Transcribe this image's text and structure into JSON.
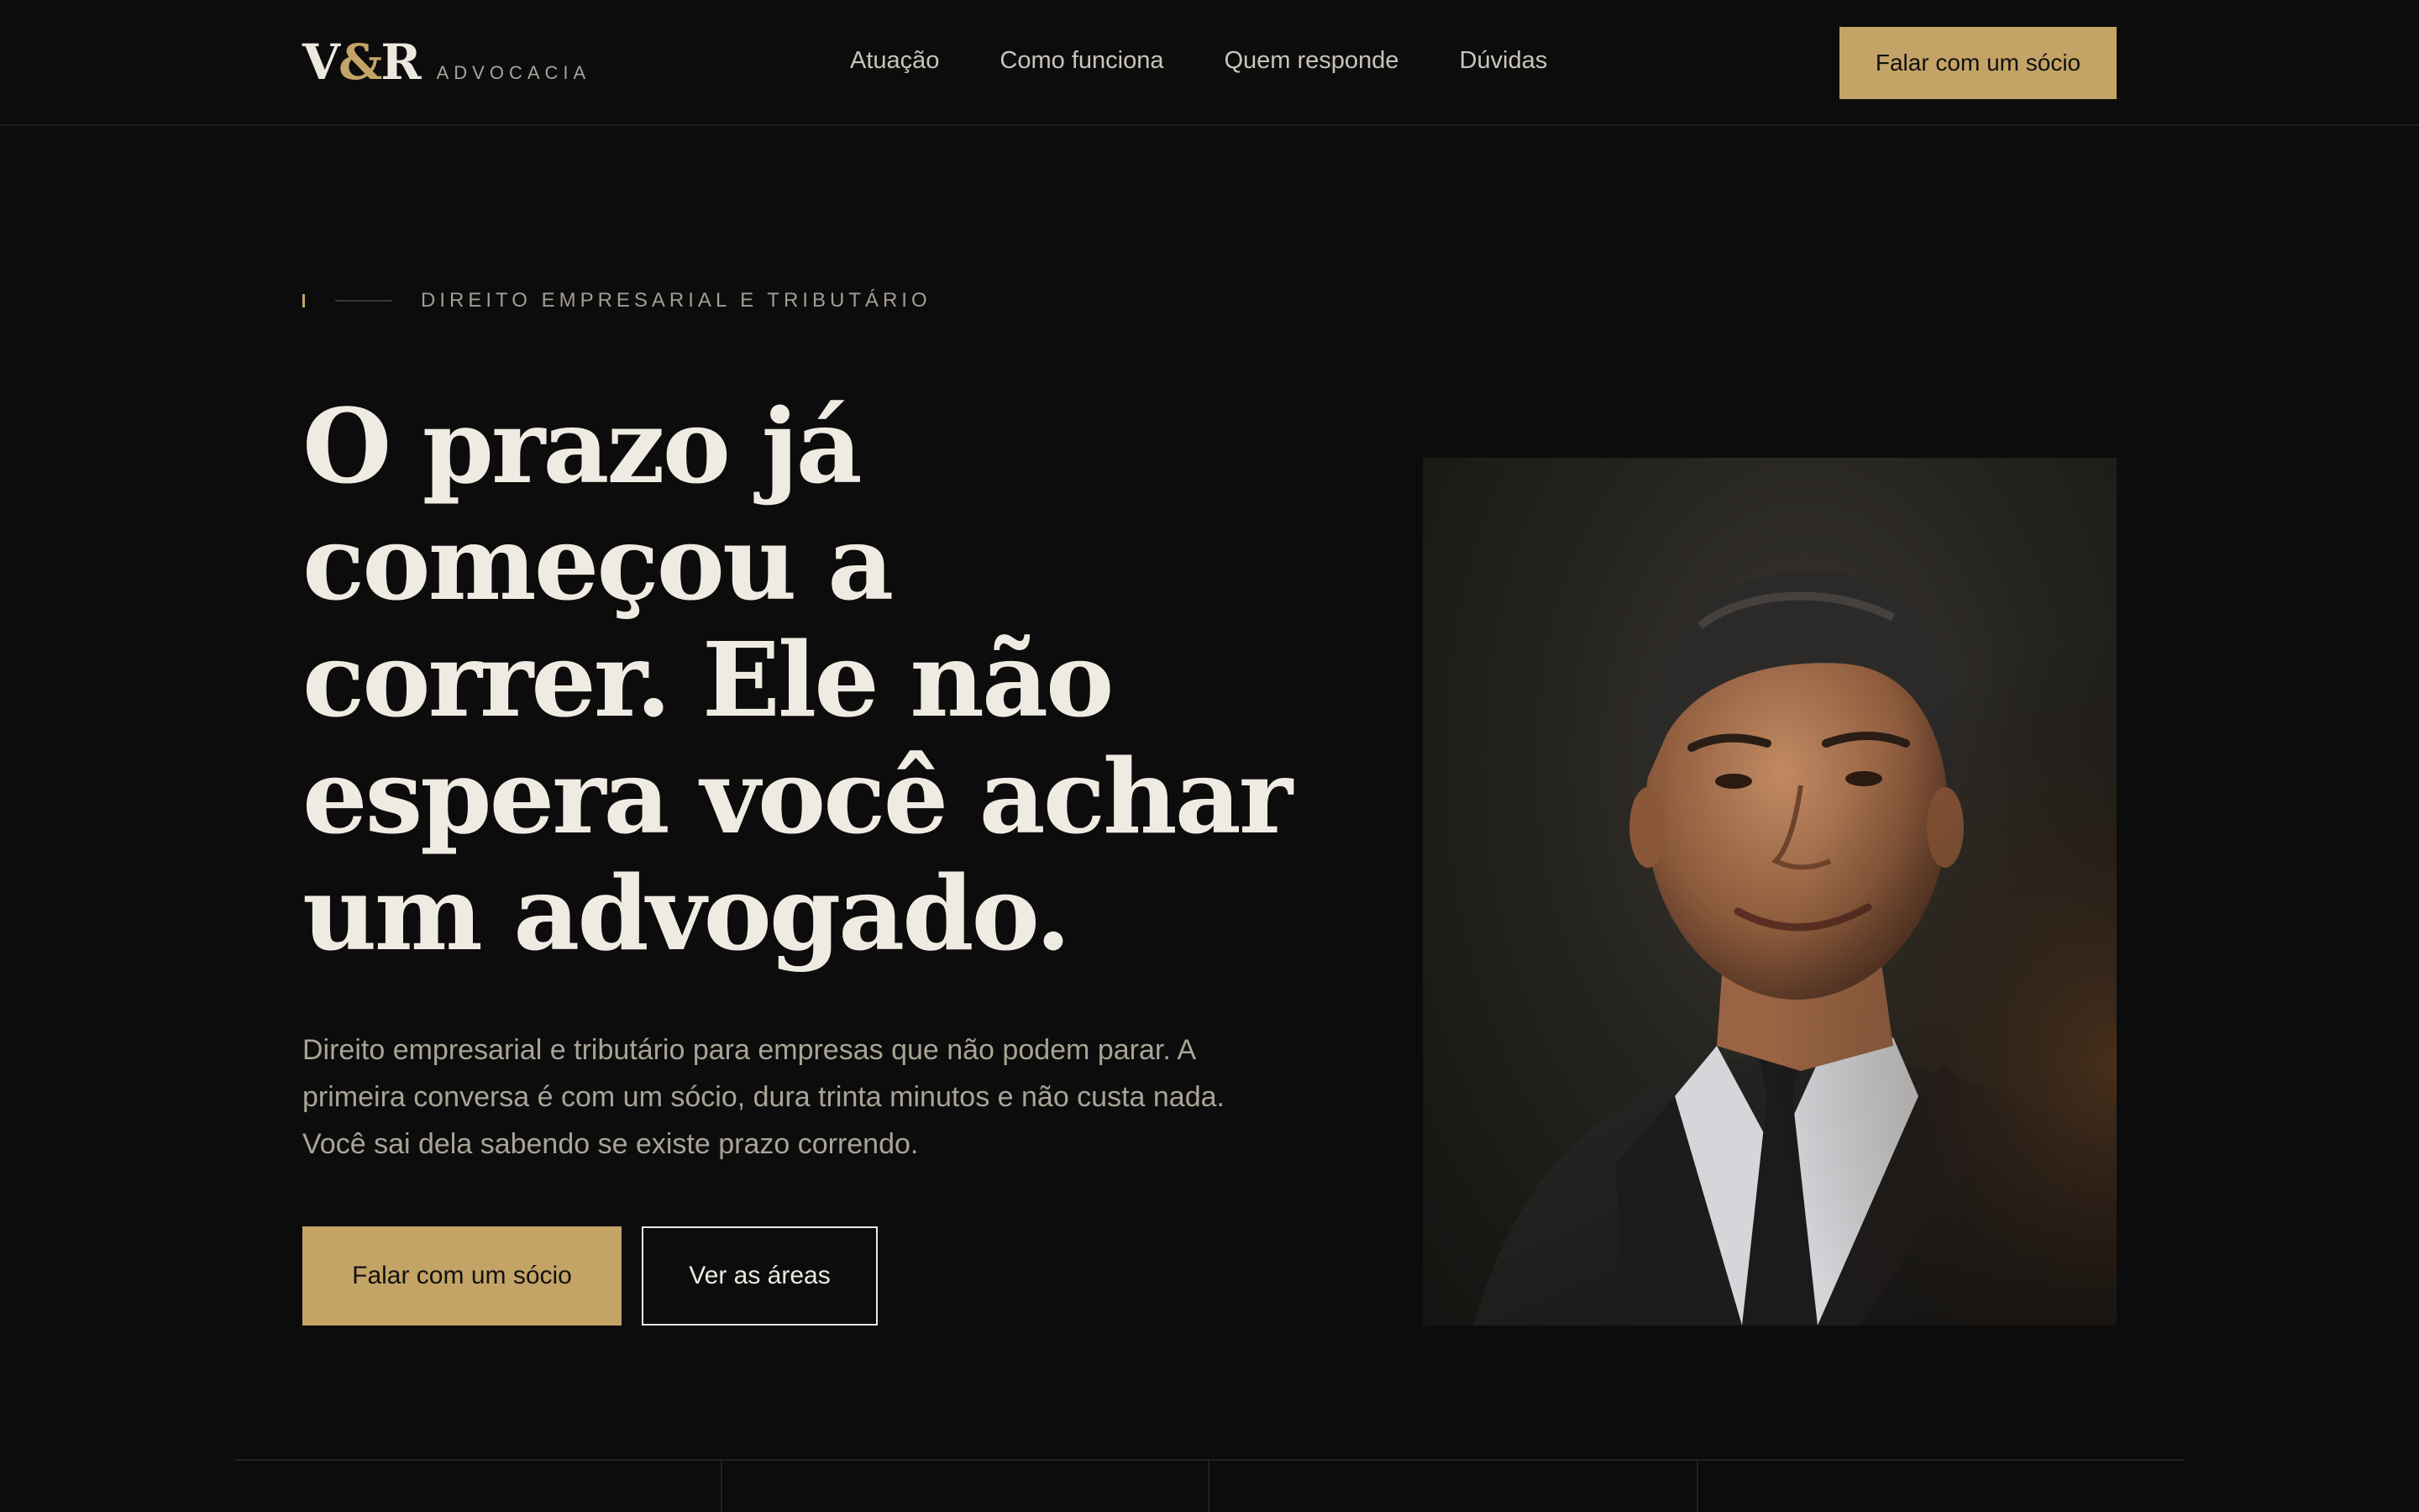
{
  "brand": {
    "mark_left": "V",
    "mark_amp": "&",
    "mark_right": "R",
    "sub": "ADVOCACIA"
  },
  "nav": {
    "items": [
      {
        "label": "Atuação"
      },
      {
        "label": "Como funciona"
      },
      {
        "label": "Quem responde"
      },
      {
        "label": "Dúvidas"
      }
    ],
    "cta_label": "Falar com um sócio"
  },
  "hero": {
    "eyebrow": "DIREITO EMPRESARIAL E TRIBUTÁRIO",
    "headline_lines": [
      "O prazo já",
      "começou a",
      "correr. Ele não",
      "espera você achar",
      "um advogado."
    ],
    "lead_lines": [
      "Direito empresarial e tributário para empresas que não podem parar. A",
      "primeira conversa é com um sócio, dura trinta minutos e não custa nada.",
      "Você sai dela sabendo se existe prazo correndo."
    ],
    "primary_cta": "Falar com um sócio",
    "secondary_cta": "Ver as áreas"
  },
  "colors": {
    "background": "#0c0c0c",
    "accent_gold": "#c4a466",
    "text_light": "#ece8df",
    "text_muted": "#a9a397"
  }
}
